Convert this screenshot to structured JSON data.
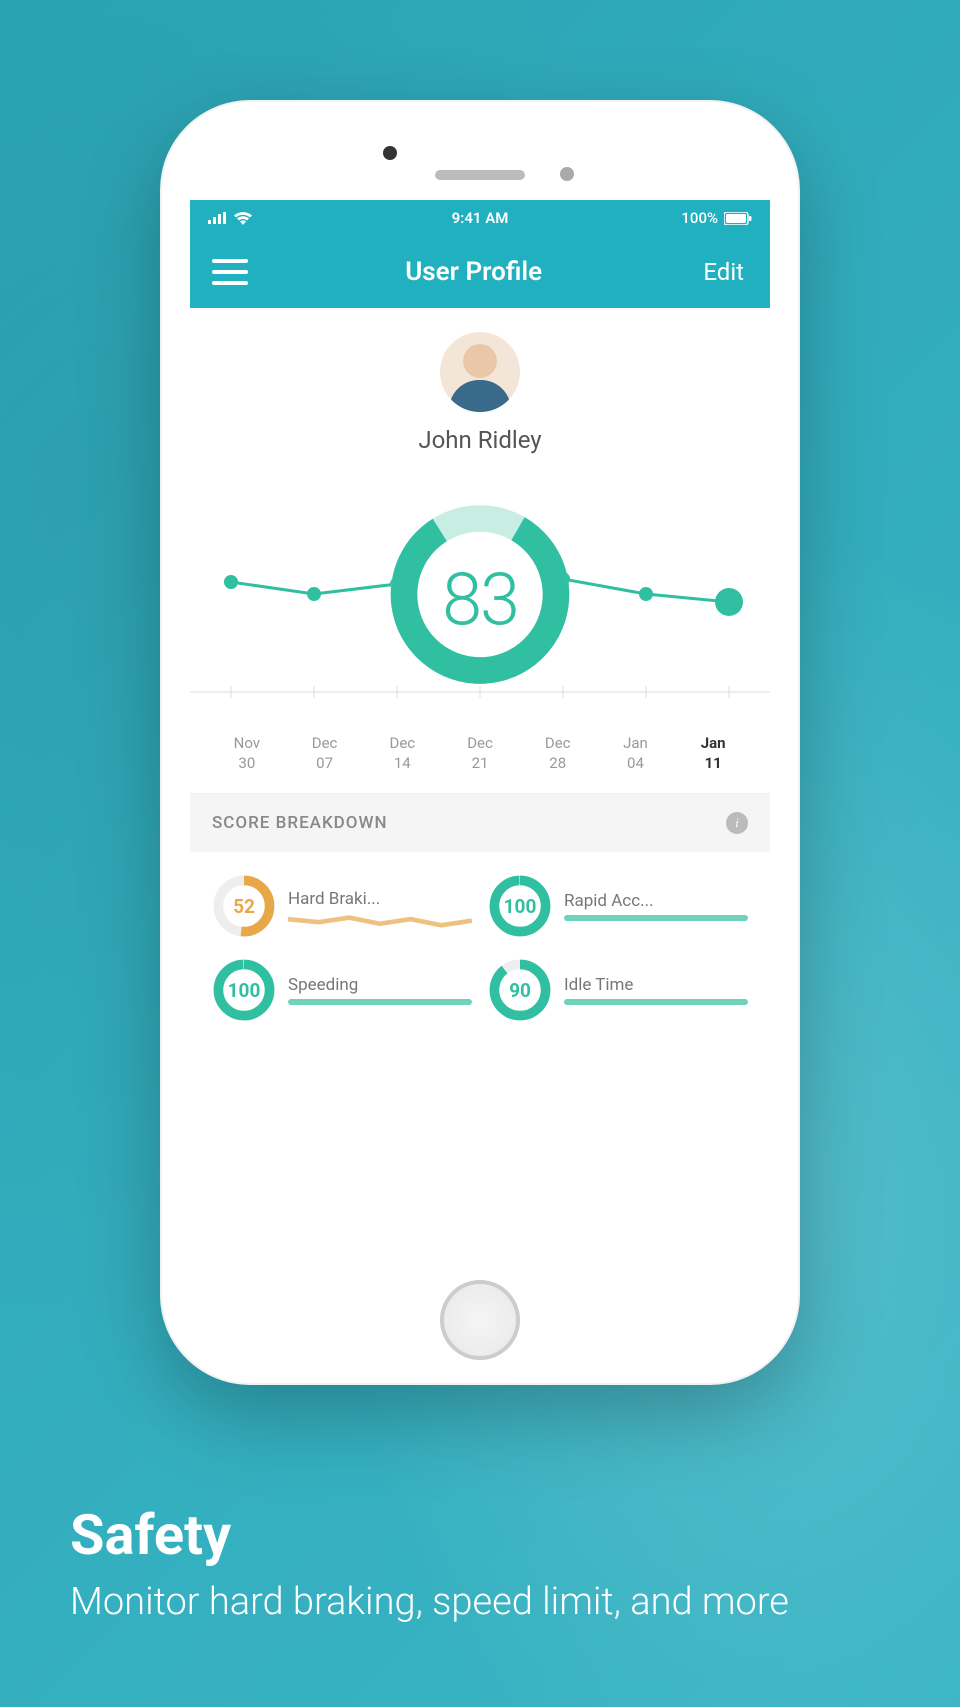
{
  "status": {
    "time": "9:41 AM",
    "battery": "100%"
  },
  "header": {
    "title": "User Profile",
    "edit_label": "Edit"
  },
  "profile": {
    "name": "John Ridley",
    "score": "83"
  },
  "chart_data": {
    "type": "line",
    "categories": [
      "Nov 30",
      "Dec 07",
      "Dec 14",
      "Dec 21",
      "Dec 28",
      "Jan 04",
      "Jan 11"
    ],
    "values": [
      82,
      80,
      83,
      83,
      84,
      80,
      78
    ],
    "ylim": [
      70,
      100
    ],
    "title": "",
    "xlabel": "",
    "ylabel": ""
  },
  "dates": [
    {
      "mo": "Nov",
      "dy": "30"
    },
    {
      "mo": "Dec",
      "dy": "07"
    },
    {
      "mo": "Dec",
      "dy": "14"
    },
    {
      "mo": "Dec",
      "dy": "21"
    },
    {
      "mo": "Dec",
      "dy": "28"
    },
    {
      "mo": "Jan",
      "dy": "04"
    },
    {
      "mo": "Jan",
      "dy": "11"
    }
  ],
  "breakdown": {
    "title": "SCORE BREAKDOWN"
  },
  "scores": [
    {
      "label": "Hard Braki...",
      "value": "52",
      "color": "#e8a84a"
    },
    {
      "label": "Rapid Acc...",
      "value": "100",
      "color": "#30bfa0"
    },
    {
      "label": "Speeding",
      "value": "100",
      "color": "#30bfa0"
    },
    {
      "label": "Idle Time",
      "value": "90",
      "color": "#30bfa0"
    }
  ],
  "promo": {
    "title": "Safety",
    "subtitle": "Monitor hard braking, speed limit, and more"
  }
}
